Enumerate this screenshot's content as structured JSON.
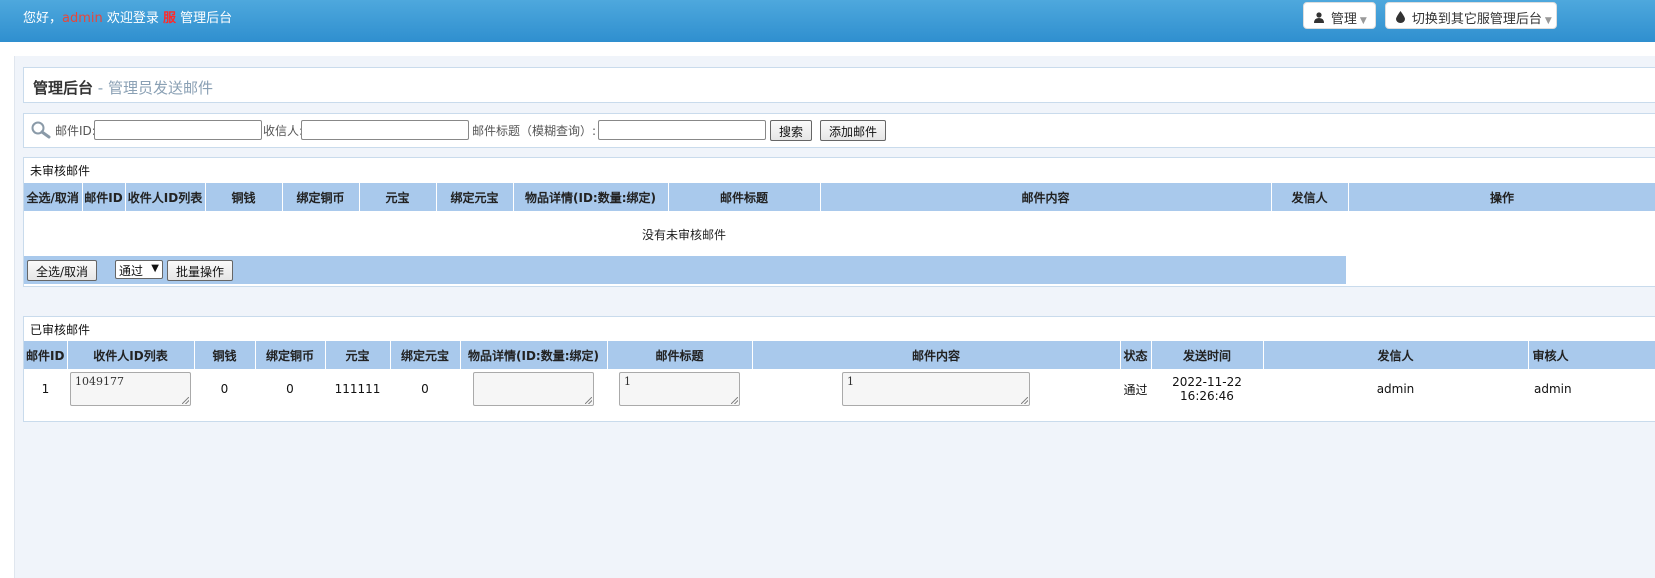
{
  "header": {
    "greeting": "您好，",
    "username": "admin",
    "welcome": " 欢迎登录 ",
    "server_mark": "服",
    "app_name": " 管理后台",
    "manage_label": "管理",
    "switch_label": "切换到其它服管理后台"
  },
  "page": {
    "title": "管理后台",
    "subtitle": " - 管理员发送邮件"
  },
  "search": {
    "mail_id_label": "邮件ID:",
    "mail_id_value": "",
    "recipient_label": "收信人:",
    "recipient_value": "",
    "title_label": "邮件标题（模糊查询）:",
    "title_value": "",
    "search_button": "搜索",
    "add_button": "添加邮件"
  },
  "pending": {
    "section_title": "未审核邮件",
    "columns": [
      "全选/取消",
      "邮件ID",
      "收件人ID列表",
      "铜钱",
      "绑定铜币",
      "元宝",
      "绑定元宝",
      "物品详情(ID:数量:绑定)",
      "邮件标题",
      "邮件内容",
      "发信人",
      "操作"
    ],
    "empty_message": "没有未审核邮件",
    "select_all_button": "全选/取消",
    "batch_select_value": "通过",
    "batch_button": "批量操作"
  },
  "approved": {
    "section_title": "已审核邮件",
    "columns": [
      "邮件ID",
      "收件人ID列表",
      "铜钱",
      "绑定铜币",
      "元宝",
      "绑定元宝",
      "物品详情(ID:数量:绑定)",
      "邮件标题",
      "邮件内容",
      "状态",
      "发送时间",
      "发信人",
      "审核人"
    ],
    "rows": [
      {
        "mail_id": "1",
        "recipients": "1049177",
        "copper": "0",
        "bound_copper": "0",
        "yuanbao": "111111",
        "bound_yuanbao": "0",
        "items": "",
        "title": "1",
        "content": "1",
        "status": "通过",
        "send_time": "2022-11-22 16:26:46",
        "sender": "admin",
        "reviewer": "admin"
      }
    ]
  },
  "colors": {
    "topbar": "#3a9ad6",
    "table_header": "#a9c9ec",
    "status_ok": "#0a8a0a",
    "username": "#e8463a"
  },
  "icons": {
    "manage": "user-icon",
    "switch": "droplet-icon",
    "search": "magnifier-icon"
  }
}
